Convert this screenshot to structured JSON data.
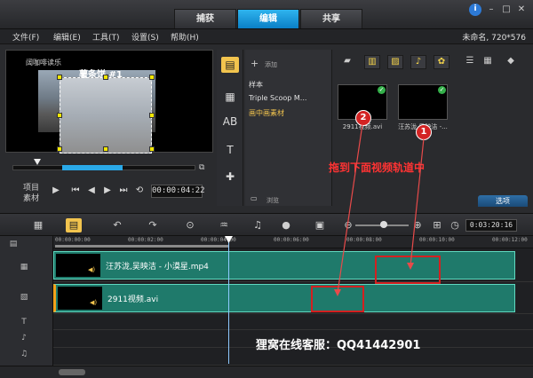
{
  "tabs": [
    "捕获",
    "编辑",
    "共享"
  ],
  "active_tab": "编辑",
  "menu": [
    "文件(F)",
    "编辑(E)",
    "工具(T)",
    "设置(S)",
    "帮助(H)"
  ],
  "project_info": "未命名, 720*576",
  "preview": {
    "overlay_text": "薯条饼 #1",
    "watermark": "阔咖啡读乐",
    "mode_labels": [
      "项目",
      "素材"
    ],
    "timecode": "00:00:04:22"
  },
  "library": {
    "add_label": "添加",
    "items": [
      "样本",
      "Triple Scoop M...",
      "画中画素材"
    ],
    "selected": "画中画素材",
    "browse_label": "浏览",
    "thumbs": [
      {
        "caption": "2911视频.avi"
      },
      {
        "caption": "汪苏泷,吴映洁 -..."
      }
    ],
    "options_label": "选项"
  },
  "instruction": "拖到下面视频轨道中",
  "badges": [
    "1",
    "2"
  ],
  "timeline": {
    "timecode": "0:03:20:16",
    "ruler": [
      "00:00:00:00",
      "00:00:02:00",
      "00:00:04:00",
      "00:00:06:00",
      "00:00:08:00",
      "00:00:10:00",
      "00:00:12:00"
    ],
    "clips": [
      {
        "label": "汪苏泷,吴映洁 - 小漠星.mp4"
      },
      {
        "label": "2911视频.avi"
      }
    ]
  },
  "service_text": "狸窝在线客服：QQ41442901",
  "colors": {
    "accent": "#0a8fd6",
    "clip": "#1f7a6b",
    "annotation": "#d42020"
  }
}
